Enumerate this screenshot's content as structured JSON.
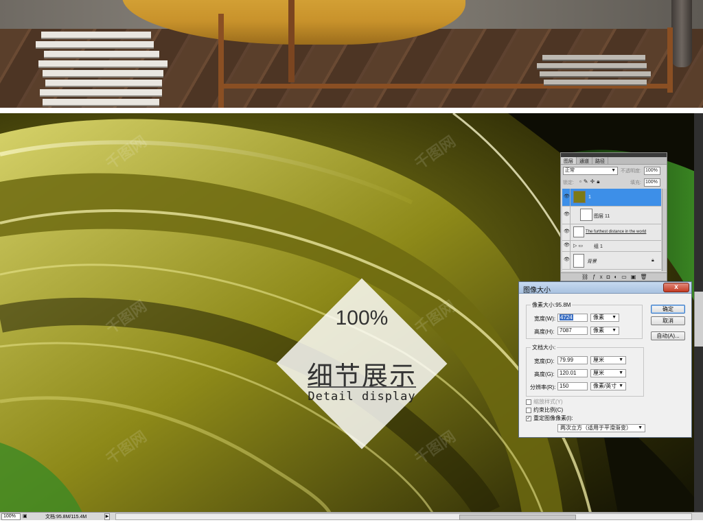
{
  "canvas": {
    "percent": "100%",
    "title_cn": "细节展示",
    "subtitle_en": "Detail display"
  },
  "layers_panel": {
    "tabs": [
      "图层",
      "通道",
      "路径"
    ],
    "blend_mode": "正常",
    "opacity_label": "不透明度:",
    "opacity_value": "100%",
    "lock_label": "锁定:",
    "fill_label": "填充:",
    "fill_value": "100%",
    "layers": [
      {
        "name": "1",
        "selected": true
      },
      {
        "name": "图层 11",
        "selected": false
      },
      {
        "name": "The furthest distance in the world",
        "selected": false
      },
      {
        "name": "组 1",
        "selected": false
      },
      {
        "name": "背景",
        "selected": false
      }
    ]
  },
  "image_size_dialog": {
    "title": "图像大小",
    "close_label": "x",
    "pixel_dims_caption": "像素大小:95.8M",
    "width_label": "宽度(W):",
    "width_value": "4724",
    "width_unit": "像素",
    "height_label": "高度(H):",
    "height_value": "7087",
    "height_unit": "像素",
    "doc_size_caption": "文档大小:",
    "doc_width_label": "宽度(D):",
    "doc_width_value": "79.99",
    "doc_width_unit": "厘米",
    "doc_height_label": "高度(G):",
    "doc_height_value": "120.01",
    "doc_height_unit": "厘米",
    "resolution_label": "分辨率(R):",
    "resolution_value": "150",
    "resolution_unit": "像素/英寸",
    "scale_styles_label": "缩放样式(Y)",
    "constrain_label": "约束比例(C)",
    "resample_label": "重定图像像素(I):",
    "resample_method": "两次立方（适用于平滑渐变）",
    "ok_label": "确定",
    "cancel_label": "取消",
    "auto_label": "自动(A)..."
  },
  "status_bar": {
    "zoom": "100%",
    "doc_info": "文档:95.8M/115.4M"
  }
}
